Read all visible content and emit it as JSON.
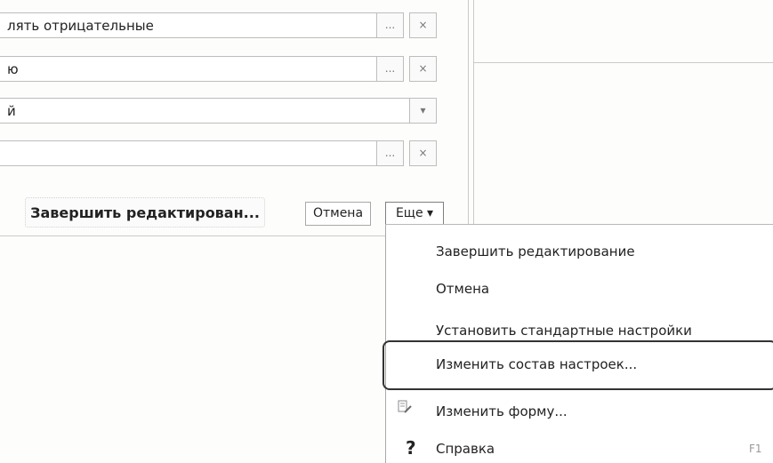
{
  "fields": [
    {
      "value": "лять отрицательные",
      "buttons": [
        "...",
        "×"
      ]
    },
    {
      "value": "ю",
      "buttons": [
        "...",
        "×"
      ]
    },
    {
      "value": "й",
      "buttons": [
        "▾"
      ]
    },
    {
      "value": "",
      "buttons": [
        "...",
        "×"
      ]
    }
  ],
  "toolbar": {
    "finish_label": "Завершить редактирован...",
    "cancel_label": "Отмена",
    "more_label": "Еще ▾"
  },
  "menu": {
    "items": [
      {
        "label": "Завершить редактирование",
        "shortcut": ""
      },
      {
        "label": "Отмена",
        "shortcut": ""
      },
      {
        "label": "Установить стандартные настройки",
        "shortcut": ""
      },
      {
        "label": "Изменить состав настроек...",
        "shortcut": ""
      },
      {
        "label": "Изменить форму...",
        "shortcut": "",
        "icon": "form-edit-icon"
      },
      {
        "label": "Справка",
        "shortcut": "F1",
        "icon": "help-icon"
      }
    ]
  },
  "icons": {
    "help_glyph": "?"
  }
}
